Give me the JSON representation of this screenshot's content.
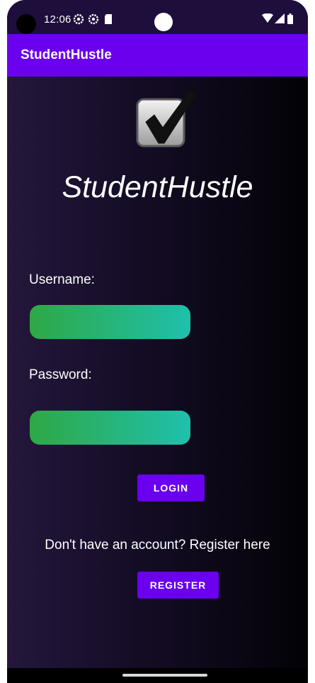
{
  "status_bar": {
    "time": "12:06",
    "icons": [
      "settings-gear-icon",
      "settings-gear-icon",
      "sd-card-icon",
      "wifi-icon",
      "signal-icon",
      "battery-icon"
    ]
  },
  "app_bar": {
    "title": "StudentHustle"
  },
  "logo": {
    "icon": "checkbox-checked-icon",
    "text": "StudentHustle"
  },
  "login_form": {
    "username_label": "Username:",
    "username_value": "",
    "password_label": "Password:",
    "password_value": "",
    "login_button": "LOGIN"
  },
  "register": {
    "prompt": "Don't have an account? Register here",
    "button": "REGISTER"
  },
  "colors": {
    "accent": "#6a00ee",
    "status_bar": "#1e0e3c",
    "field_gradient_start": "#2fa845",
    "field_gradient_end": "#1fc0ad"
  }
}
